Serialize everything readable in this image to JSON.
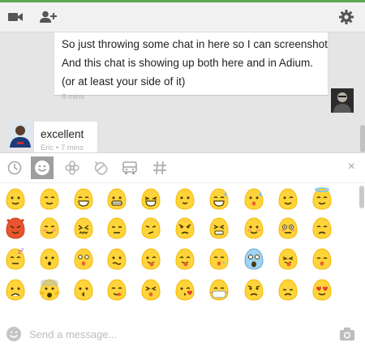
{
  "accent_color": "#5fa653",
  "toolbar": {
    "video_icon": "video-camera-icon",
    "add_person_icon": "add-person-icon",
    "settings_icon": "gear-icon"
  },
  "messages": [
    {
      "sender": "me",
      "lines": [
        "So just throwing some chat in here so I can screenshot",
        "And this chat is showing up both here and in Adium.",
        "(or at least your side of it)"
      ],
      "meta": "8 mins"
    },
    {
      "sender": "other",
      "lines": [
        "excellent"
      ],
      "meta": "Eric • 7 mins"
    }
  ],
  "emoji_picker": {
    "categories": [
      {
        "icon": "clock-icon",
        "active": false
      },
      {
        "icon": "smiley-icon",
        "active": true
      },
      {
        "icon": "flower-icon",
        "active": false
      },
      {
        "icon": "bell-icon",
        "active": false
      },
      {
        "icon": "car-icon",
        "active": false
      },
      {
        "icon": "hashtag-icon",
        "active": false
      }
    ],
    "close_label": "×",
    "rows": [
      [
        "smile",
        "smirk",
        "grin",
        "grimace",
        "laughing",
        "neutral-smile",
        "sweat-smile",
        "cold-sweat",
        "wink",
        "innocent"
      ],
      [
        "smiling-imp",
        "relaxed",
        "confounded",
        "expressionless",
        "unamused",
        "angry",
        "persevere",
        "blush",
        "flushed",
        "disappointed"
      ],
      [
        "sleepy",
        "hushed",
        "astonished",
        "confused",
        "tongue-wink",
        "tongue-closed",
        "sleeping",
        "scream",
        "tongue-squint",
        "weary"
      ],
      [
        "frowning",
        "fearful",
        "kissing",
        "yum",
        "tired",
        "kissing-heart",
        "mask",
        "worried",
        "pensive",
        "heart-eyes"
      ]
    ]
  },
  "composer": {
    "placeholder": "Send a message...",
    "emoji_icon": "smiley-icon",
    "camera_icon": "camera-icon"
  }
}
